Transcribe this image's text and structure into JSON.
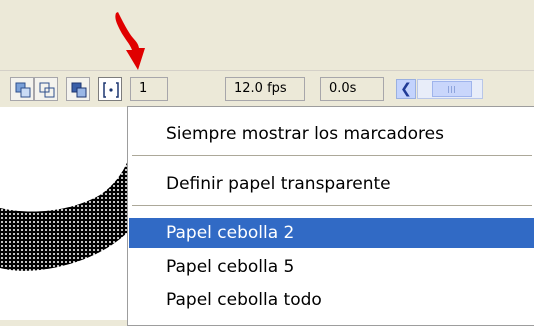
{
  "timeline": {
    "frame_number": "1",
    "fps": "12.0 fps",
    "elapsed_time": "0.0s"
  },
  "menu": {
    "items": [
      {
        "label": "Siempre mostrar los marcadores"
      },
      {
        "label": "Definir papel transparente"
      },
      {
        "label": "Papel cebolla 2",
        "highlighted": true
      },
      {
        "label": "Papel cebolla 5"
      },
      {
        "label": "Papel cebolla todo"
      }
    ]
  },
  "colors": {
    "toolbar_bg": "#ece9d8",
    "menu_highlight": "#316ac5",
    "indicator_arrow": "#e00000"
  }
}
